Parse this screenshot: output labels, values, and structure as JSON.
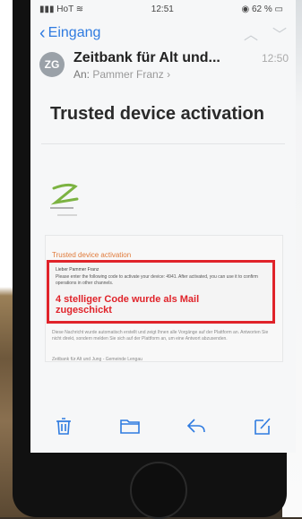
{
  "status": {
    "carrier": "HoT",
    "time": "12:51",
    "battery": "62 %"
  },
  "nav": {
    "back_label": "Eingang"
  },
  "message": {
    "avatar_initials": "ZG",
    "sender": "Zeitbank für Alt und...",
    "time": "12:50",
    "to_prefix": "An:",
    "to_name": "Pammer Franz",
    "subject": "Trusted device activation"
  },
  "email_body": {
    "heading": "Trusted device activation",
    "greeting": "Lieber Pammer Franz",
    "text": "Please enter the following code to activate your device: 4941. After activated, you can use it to confirm operations in other channels.",
    "annotation": "4 stelliger Code wurde als Mail zugeschickt",
    "footer": "Diese Nachricht wurde automatisch erstellt und zeigt Ihnen alle Vorgänge auf der Plattform an. Antworten Sie nicht direkt, sondern melden Sie sich auf der Plattform an, um eine Antwort abzusenden.",
    "signature": "Zeitbank für Alt und Jung - Gemeinde Lengau"
  },
  "toolbar": {
    "icons": [
      "trash-icon",
      "folder-icon",
      "reply-icon",
      "compose-icon"
    ]
  },
  "colors": {
    "accent": "#2f7be0",
    "annotation_red": "#e0232a",
    "logo_green": "#7cb342"
  }
}
